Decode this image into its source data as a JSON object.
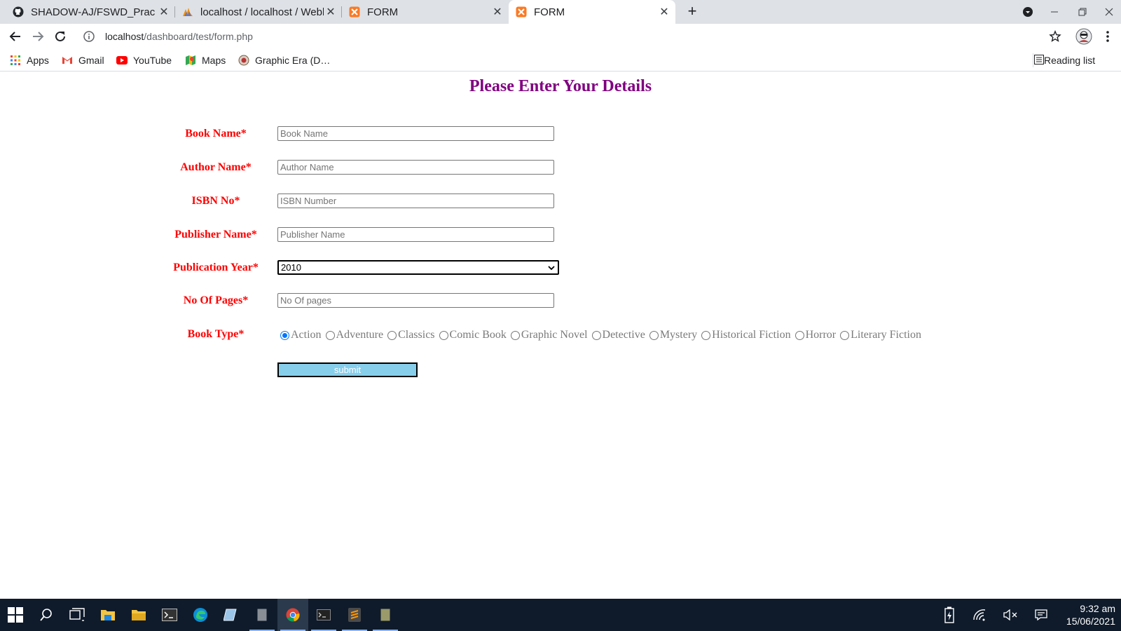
{
  "browser": {
    "tabs": [
      {
        "title": "SHADOW-AJ/FSWD_Prac",
        "icon": "github-icon"
      },
      {
        "title": "localhost / localhost / Webl",
        "icon": "phpmyadmin-icon"
      },
      {
        "title": "FORM",
        "icon": "xampp-icon"
      },
      {
        "title": "FORM",
        "icon": "xampp-icon",
        "active": true
      }
    ],
    "url_host": "localhost",
    "url_path": "/dashboard/test/form.php",
    "bookmarks": [
      "Apps",
      "Gmail",
      "YouTube",
      "Maps",
      "Graphic Era (D…"
    ],
    "reading_list": "Reading list"
  },
  "form": {
    "heading": "Please Enter Your Details",
    "book_name": {
      "label": "Book Name*",
      "placeholder": "Book Name"
    },
    "author_name": {
      "label": "Author Name*",
      "placeholder": "Author Name"
    },
    "isbn": {
      "label": "ISBN No*",
      "placeholder": "ISBN Number"
    },
    "publisher": {
      "label": "Publisher Name*",
      "placeholder": "Publisher Name"
    },
    "year": {
      "label": "Publication Year*",
      "value": "2010"
    },
    "pages": {
      "label": "No Of Pages*",
      "placeholder": "No Of pages"
    },
    "book_type": {
      "label": "Book Type*",
      "options": [
        "Action",
        "Adventure",
        "Classics",
        "Comic Book",
        "Graphic Novel",
        "Detective",
        "Mystery",
        "Historical Fiction",
        "Horror",
        "Literary Fiction"
      ],
      "selected": "Action"
    },
    "submit_label": "submit"
  },
  "taskbar": {
    "time": "9:32 am",
    "date": "15/06/2021"
  },
  "colors": {
    "heading": "#800080",
    "label": "#ff0000",
    "submit_bg": "#87ceeb",
    "taskbar_bg": "#0f1b2b",
    "radio_accent": "#0075ff"
  }
}
